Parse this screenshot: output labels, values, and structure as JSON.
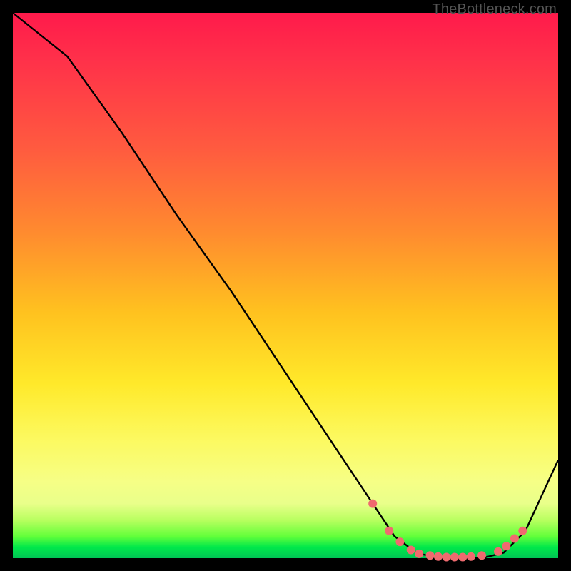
{
  "watermark": "TheBottleneck.com",
  "colors": {
    "frame": "#000000",
    "line": "#000000",
    "marker": "#ef6a6f",
    "gradient_top": "#ff1a4b",
    "gradient_bottom": "#00c455"
  },
  "chart_data": {
    "type": "line",
    "title": "",
    "xlabel": "",
    "ylabel": "",
    "xlim": [
      0,
      100
    ],
    "ylim": [
      0,
      100
    ],
    "series": [
      {
        "name": "bottleneck-curve",
        "x": [
          0,
          10,
          20,
          30,
          40,
          50,
          60,
          66,
          70,
          74,
          78,
          82,
          86,
          90,
          94,
          100
        ],
        "y": [
          100,
          92,
          78,
          63,
          49,
          34,
          19,
          10,
          4,
          1,
          0,
          0,
          0,
          1,
          5,
          18
        ]
      }
    ],
    "markers": {
      "name": "highlighted-points",
      "x": [
        66,
        69,
        71,
        73,
        74.5,
        76.5,
        78,
        79.5,
        81,
        82.5,
        84,
        86,
        89,
        90.5,
        92,
        93.5
      ],
      "y": [
        10,
        5,
        3,
        1.5,
        0.8,
        0.5,
        0.3,
        0.2,
        0.2,
        0.2,
        0.3,
        0.5,
        1.2,
        2.2,
        3.6,
        5.0
      ]
    }
  }
}
